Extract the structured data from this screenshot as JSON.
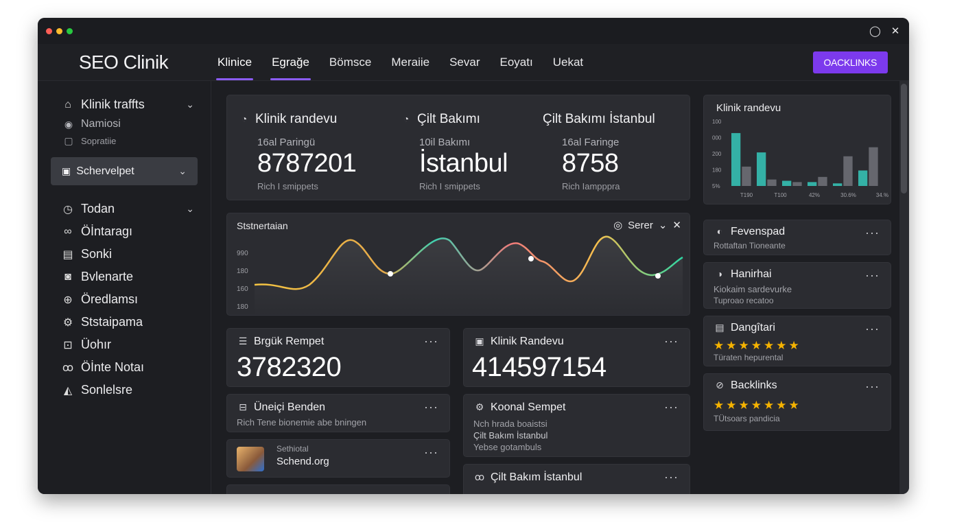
{
  "app": {
    "brand": "SEO Clinik",
    "cta": "OACKLINKS"
  },
  "colors": {
    "accent": "#7c3aed",
    "star": "#f5b301",
    "bg": "#1d1e22",
    "card": "#2b2c31"
  },
  "nav": [
    "Klinice",
    "Egrağe",
    "Bömsce",
    "Meraiie",
    "Sevar",
    "Eoyatı",
    "Uekat"
  ],
  "sidebar": {
    "group": {
      "label": "Klinik traffts",
      "icon": "home-icon"
    },
    "subs": [
      {
        "label": "Namiosi",
        "icon": "circle-icon"
      },
      {
        "label": "Sopratiie",
        "icon": "chat-icon"
      }
    ],
    "selected": {
      "label": "Schervelpet",
      "icon": "inbox-icon"
    },
    "items": [
      {
        "label": "Todan",
        "icon": "clock-icon"
      },
      {
        "label": "Öİntaragı",
        "icon": "link-icon"
      },
      {
        "label": "Sonki",
        "icon": "window-icon"
      },
      {
        "label": "Bvlenarte",
        "icon": "camera-icon"
      },
      {
        "label": "Öredlamsı",
        "icon": "globe-icon"
      },
      {
        "label": "Ststaipama",
        "icon": "gear-icon"
      },
      {
        "label": "Üohır",
        "icon": "screen-icon"
      },
      {
        "label": "Öİnte Notaı",
        "icon": "users-icon"
      },
      {
        "label": "Sonlelsre",
        "icon": "thumb-icon"
      }
    ]
  },
  "stats": [
    {
      "title": "Klinik randevu",
      "label": "16al Paringü",
      "value": "8787201",
      "sub": "Rich I smippets"
    },
    {
      "title": "Çilt Bakımı",
      "label": "10il Bakımı",
      "value": "İstanbul",
      "sub": "Rich I smippets"
    },
    {
      "title": "Çilt Bakımı İstanbul",
      "label": "16al Faringe",
      "value": "8758",
      "sub": "Rich Iampppra"
    }
  ],
  "line_chart": {
    "title": "Ststnertaian",
    "control": "Serer",
    "yticks": [
      "990",
      "180",
      "160",
      "180"
    ]
  },
  "chart_data": {
    "type": "bar",
    "title": "Klinik randevu",
    "yticks": [
      "100",
      "000",
      "200",
      "180",
      "5%"
    ],
    "xticks": [
      "T190",
      "T100",
      "42%",
      "30.6%",
      "34.%"
    ],
    "series": [
      {
        "values": [
          82,
          52,
          8,
          6,
          4,
          24
        ]
      },
      {
        "values": [
          30,
          10,
          6,
          14,
          46,
          60
        ]
      }
    ],
    "ylim": [
      0,
      100
    ]
  },
  "metrics": [
    {
      "title": "Brgük Rempet",
      "value": "3782320"
    },
    {
      "title": "Klinik Randevu",
      "value": "414597154"
    }
  ],
  "list_left": [
    {
      "title": "Üneiçi Benden",
      "sub": "Rich Tene bionemie abe bningen"
    },
    {
      "label": "Sethiotal",
      "title": "Schend.org"
    }
  ],
  "list_mid": [
    {
      "title": "Koonal Sempet",
      "lines": [
        "Nch hrada boaistsi",
        "Çilt Bakım İstanbul",
        "Yebse gotambuls"
      ]
    },
    {
      "title": "Çilt Bakım İstanbul"
    }
  ],
  "right_cards": [
    {
      "title": "Fevenspad",
      "lines": [
        "Rottaftan Tioneante"
      ]
    },
    {
      "title": "Hanirhai",
      "lines": [
        "Kiokaim sardevurke",
        "Tuproao recatoo"
      ]
    },
    {
      "title": "Dangîtari",
      "stars": "★★★★★★★",
      "lines": [
        "Türaten hepurental"
      ]
    },
    {
      "title": "Backlinks",
      "stars": "★★★★★★★",
      "lines": [
        "TÜtsoars pandicia"
      ]
    }
  ]
}
